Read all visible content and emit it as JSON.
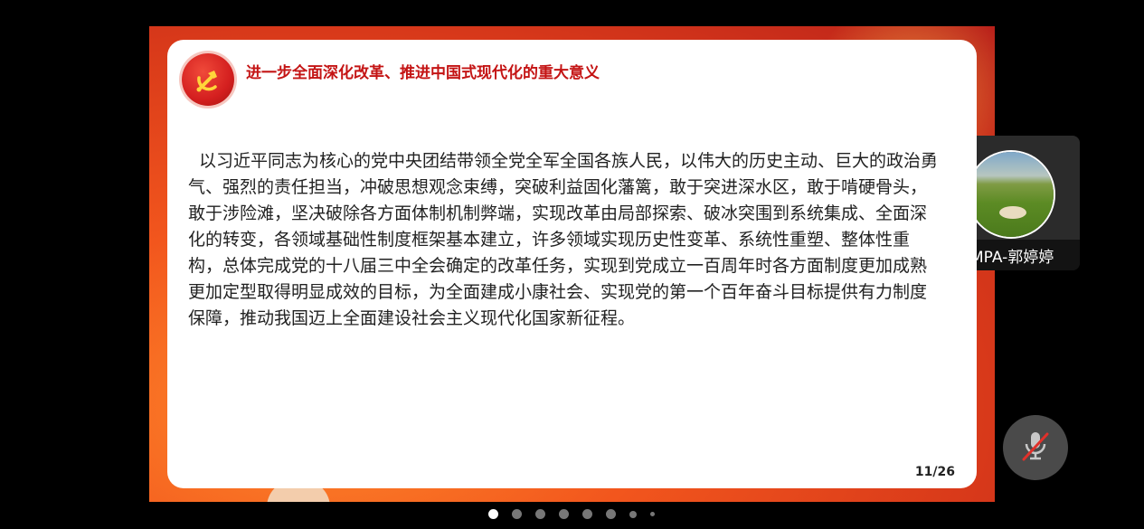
{
  "slide": {
    "title": "进一步全面深化改革、推进中国式现代化的重大意义",
    "body": "以习近平同志为核心的党中央团结带领全党全军全国各族人民，以伟大的历史主动、巨大的政治勇气、强烈的责任担当，冲破思想观念束缚，突破利益固化藩篱，敢于突进深水区，敢于啃硬骨头，敢于涉险滩，坚决破除各方面体制机制弊端，实现改革由局部探索、破冰突围到系统集成、全面深化的转变，各领域基础性制度框架基本建立，许多领域实现历史性变革、系统性重塑、整体性重构，总体完成党的十八届三中全会确定的改革任务，实现到党成立一百周年时各方面制度更加成熟更加定型取得明显成效的目标，为全面建成小康社会、实现党的第一个百年奋斗目标提供有力制度保障，推动我国迈上全面建设社会主义现代化国家新征程。",
    "page_number": "11/26",
    "emblem_icon": "party-emblem-icon"
  },
  "participant": {
    "name": "MPA-郭婷婷",
    "mic_icon": "microphone-icon"
  },
  "controls": {
    "mute_icon": "microphone-muted-icon"
  },
  "pager": {
    "count": 8,
    "active_index": 0
  },
  "colors": {
    "title_red": "#c41414",
    "slide_bg": "#e8461c",
    "background": "#000000"
  }
}
